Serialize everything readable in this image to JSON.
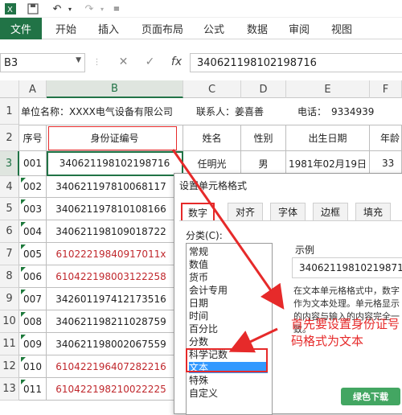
{
  "qat": {
    "save_icon": "save-icon",
    "undo_icon": "undo-icon",
    "redo_icon": "redo-icon"
  },
  "ribbon": {
    "tabs": [
      "文件",
      "开始",
      "插入",
      "页面布局",
      "公式",
      "数据",
      "审阅",
      "视图"
    ]
  },
  "formula_bar": {
    "name_box": "B3",
    "fx": "fx",
    "value": "340621198102198716"
  },
  "columns": [
    "A",
    "B",
    "C",
    "D",
    "E",
    "F"
  ],
  "rows": [
    "1",
    "2",
    "3",
    "4",
    "5",
    "6",
    "7",
    "8",
    "9",
    "10",
    "11",
    "12",
    "13"
  ],
  "sheet": {
    "row1": {
      "company": "单位名称：XXXX电气设备有限公司",
      "contact": "联系人：姜喜善",
      "phone": "电话：　9334939"
    },
    "headers": [
      "序号",
      "身份证编号",
      "姓名",
      "性别",
      "出生日期",
      "年龄"
    ],
    "row3": {
      "num": "001",
      "id": "340621198102198716",
      "name": "任明光",
      "gender": "男",
      "birth": "1981年02月19日",
      "age": "33"
    },
    "rows": [
      {
        "num": "002",
        "id": "340621197810068117",
        "red": false
      },
      {
        "num": "003",
        "id": "340621197810108166",
        "red": false
      },
      {
        "num": "004",
        "id": "340621198109018722",
        "red": false
      },
      {
        "num": "005",
        "id": "61022219840917011x",
        "red": true
      },
      {
        "num": "006",
        "id": "610422198003122258",
        "red": true
      },
      {
        "num": "007",
        "id": "342601197412173516",
        "red": false
      },
      {
        "num": "008",
        "id": "340621198211028759",
        "red": false
      },
      {
        "num": "009",
        "id": "340621198002067559",
        "red": false
      },
      {
        "num": "010",
        "id": "610422196407282216",
        "red": true
      },
      {
        "num": "011",
        "id": "610422198210022225",
        "red": true
      }
    ]
  },
  "dialog": {
    "title": "设置单元格格式",
    "tabs": [
      "数字",
      "对齐",
      "字体",
      "边框",
      "填充"
    ],
    "category_label": "分类(C):",
    "categories": [
      "常规",
      "数值",
      "货币",
      "会计专用",
      "日期",
      "时间",
      "百分比",
      "分数",
      "科学记数",
      "文本",
      "特殊",
      "自定义"
    ],
    "selected_category": "文本",
    "sample_label": "示例",
    "sample_value": "340621198102198716",
    "description": "在文本单元格格式中，数字作为文本处理。单元格显示的内容与输入的内容完全一致。"
  },
  "annotation": {
    "note": "首先要设置身份证号码格式为文本",
    "color": "#e62a2a"
  },
  "watermark": "绿色下载"
}
